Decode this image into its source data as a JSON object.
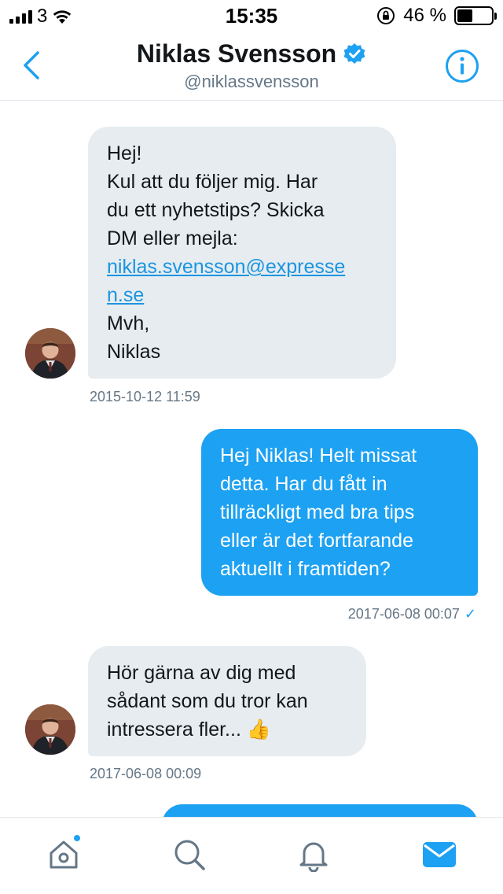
{
  "status_bar": {
    "carrier": "3",
    "time": "15:35",
    "battery": "46 %",
    "battery_level": 0.46
  },
  "header": {
    "title": "Niklas Svensson",
    "handle": "@niklassvensson",
    "verified": true
  },
  "messages": [
    {
      "direction": "incoming",
      "lines": [
        "Hej!",
        "Kul att du följer mig. Har",
        "du ett nyhetstips? Skicka",
        "DM eller mejla:"
      ],
      "link_lines": [
        "niklas.svensson@expresse",
        "n.se"
      ],
      "closing_lines": [
        "Mvh,",
        "Niklas"
      ],
      "timestamp": "2015-10-12 11:59"
    },
    {
      "direction": "outgoing",
      "lines": [
        "Hej Niklas! Helt missat",
        "detta. Har du fått in",
        "tillräckligt med bra tips",
        "eller är det fortfarande",
        "aktuellt i framtiden?"
      ],
      "timestamp": "2017-06-08 00:07",
      "read_check": "✓"
    },
    {
      "direction": "incoming",
      "lines": [
        "Hör gärna av dig med",
        "sådant som du tror kan",
        "intressera fler... 👍"
      ],
      "timestamp": "2017-06-08 00:09"
    }
  ],
  "tabbar": {
    "items": [
      "home-icon",
      "search-icon",
      "notifications-icon",
      "messages-icon"
    ],
    "active": "messages-icon",
    "home_has_notification": true
  },
  "colors": {
    "accent": "#1da1f2",
    "incoming_bubble": "#e6ecf0",
    "muted_text": "#657786"
  }
}
